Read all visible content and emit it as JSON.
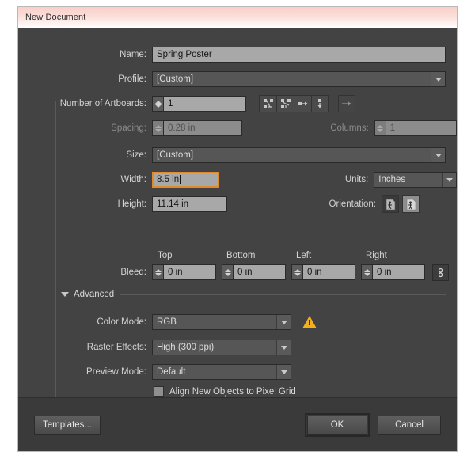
{
  "window": {
    "title": "New Document"
  },
  "fields": {
    "name_label": "Name:",
    "name_value": "Spring Poster",
    "profile_label": "Profile:",
    "profile_value": "[Custom]",
    "artboards_label": "Number of Artboards:",
    "artboards_value": "1",
    "spacing_label": "Spacing:",
    "spacing_value": "0.28 in",
    "columns_label": "Columns:",
    "columns_value": "1",
    "size_label": "Size:",
    "size_value": "[Custom]",
    "width_label": "Width:",
    "width_value": "8.5 in",
    "units_label": "Units:",
    "units_value": "Inches",
    "height_label": "Height:",
    "height_value": "11.14 in",
    "orientation_label": "Orientation:",
    "bleed_label": "Bleed:",
    "bleed_top_header": "Top",
    "bleed_bottom_header": "Bottom",
    "bleed_left_header": "Left",
    "bleed_right_header": "Right",
    "bleed_top_value": "0 in",
    "bleed_bottom_value": "0 in",
    "bleed_left_value": "0 in",
    "bleed_right_value": "0 in"
  },
  "advanced": {
    "section_label": "Advanced",
    "color_mode_label": "Color Mode:",
    "color_mode_value": "RGB",
    "raster_label": "Raster Effects:",
    "raster_value": "High (300 ppi)",
    "preview_label": "Preview Mode:",
    "preview_value": "Default",
    "align_pixel_grid_label": "Align New Objects to Pixel Grid",
    "align_pixel_grid_checked": false
  },
  "icons": {
    "artboard_grid_row": "artboard-grid-by-row-icon",
    "artboard_grid_column": "artboard-grid-by-column-icon",
    "artboard_row": "artboard-arrange-row-icon",
    "artboard_column": "artboard-arrange-column-icon",
    "artboard_direction": "artboard-flow-direction-icon",
    "orientation_portrait": "orientation-portrait-icon",
    "orientation_landscape": "orientation-landscape-icon",
    "bleed_link": "bleed-link-icon",
    "color_mode_warning": "warning-icon",
    "advanced_disclosure": "triangle-down-icon"
  },
  "footer": {
    "templates_label": "Templates...",
    "ok_label": "OK",
    "cancel_label": "Cancel"
  },
  "colors": {
    "dialog_bg": "#434343",
    "field_bg": "#a8a8a8",
    "combo_bg": "#565656",
    "focus_orange": "#e08a2e",
    "warning_yellow": "#f2b01e",
    "titlebar_pink": "#f9cfc8"
  }
}
